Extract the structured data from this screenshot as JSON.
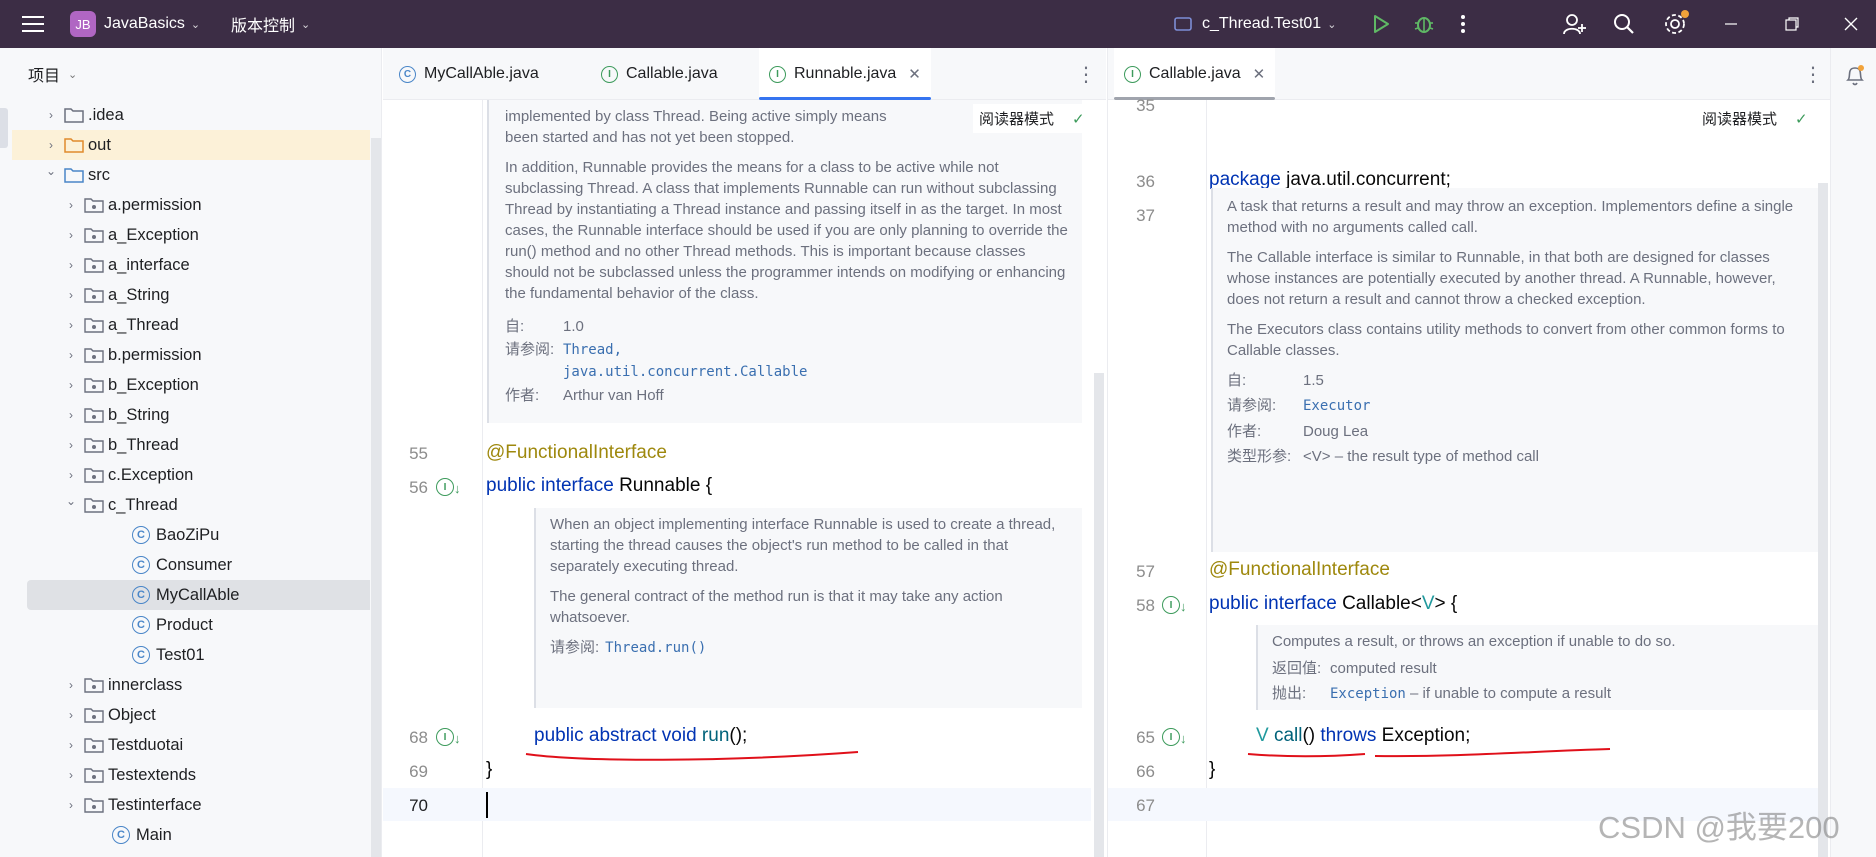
{
  "titlebar": {
    "project_badge": "JB",
    "project_name": "JavaBasics",
    "vcs_label": "版本控制",
    "run_config": "c_Thread.Test01",
    "icons": [
      "hamburger-menu-icon",
      "run-icon",
      "debug-icon",
      "more-vertical-icon",
      "add-user-icon",
      "search-icon",
      "settings-icon",
      "minimize-icon",
      "restore-icon",
      "close-icon"
    ]
  },
  "project_panel": {
    "title": "项目",
    "tree": [
      {
        "label": ".idea",
        "kind": "folder",
        "depth": 1,
        "expanded": false
      },
      {
        "label": "out",
        "kind": "folder-excluded",
        "depth": 1,
        "expanded": false,
        "highlight": true
      },
      {
        "label": "src",
        "kind": "folder-source",
        "depth": 1,
        "expanded": true
      },
      {
        "label": "a.permission",
        "kind": "package",
        "depth": 2,
        "expanded": false
      },
      {
        "label": "a_Exception",
        "kind": "package",
        "depth": 2,
        "expanded": false
      },
      {
        "label": "a_interface",
        "kind": "package",
        "depth": 2,
        "expanded": false
      },
      {
        "label": "a_String",
        "kind": "package",
        "depth": 2,
        "expanded": false
      },
      {
        "label": "a_Thread",
        "kind": "package",
        "depth": 2,
        "expanded": false
      },
      {
        "label": "b.permission",
        "kind": "package",
        "depth": 2,
        "expanded": false
      },
      {
        "label": "b_Exception",
        "kind": "package",
        "depth": 2,
        "expanded": false
      },
      {
        "label": "b_String",
        "kind": "package",
        "depth": 2,
        "expanded": false
      },
      {
        "label": "b_Thread",
        "kind": "package",
        "depth": 2,
        "expanded": false
      },
      {
        "label": "c.Exception",
        "kind": "package",
        "depth": 2,
        "expanded": false
      },
      {
        "label": "c_Thread",
        "kind": "package",
        "depth": 2,
        "expanded": true
      },
      {
        "label": "BaoZiPu",
        "kind": "class",
        "depth": 3
      },
      {
        "label": "Consumer",
        "kind": "class",
        "depth": 3
      },
      {
        "label": "MyCallAble",
        "kind": "class",
        "depth": 3,
        "selected": true
      },
      {
        "label": "Product",
        "kind": "class",
        "depth": 3
      },
      {
        "label": "Test01",
        "kind": "class",
        "depth": 3
      },
      {
        "label": "innerclass",
        "kind": "package",
        "depth": 2,
        "expanded": false
      },
      {
        "label": "Object",
        "kind": "package",
        "depth": 2,
        "expanded": false
      },
      {
        "label": "Testduotai",
        "kind": "package",
        "depth": 2,
        "expanded": false
      },
      {
        "label": "Testextends",
        "kind": "package",
        "depth": 2,
        "expanded": false
      },
      {
        "label": "Testinterface",
        "kind": "package",
        "depth": 2,
        "expanded": false
      },
      {
        "label": "Main",
        "kind": "class",
        "depth": 2
      }
    ]
  },
  "left_editor": {
    "tabs": [
      {
        "label": "MyCallAble.java",
        "icon": "C",
        "active": false
      },
      {
        "label": "Callable.java",
        "icon": "I",
        "active": false
      },
      {
        "label": "Runnable.java",
        "icon": "I",
        "active": true
      }
    ],
    "reader_mode": "阅读器模式",
    "doc_top": {
      "partial_1": "implemented by class Thread. Being active simply means",
      "partial_2": "been started and has not yet been stopped.",
      "para": "In addition, Runnable provides the means for a class to be active while not subclassing Thread. A class that implements Runnable can run without subclassing Thread by instantiating a Thread instance and passing itself in as the target. In most cases, the Runnable interface should be used if you are only planning to override the run() method and no other Thread methods. This is important because classes should not be subclassed unless the programmer intends on modifying or enhancing the fundamental behavior of the class.",
      "since_label": "自:",
      "since_value": "1.0",
      "see_label": "请参阅:",
      "see_1": "Thread,",
      "see_2": "java.util.concurrent.Callable",
      "author_label": "作者:",
      "author_value": "Arthur van Hoff"
    },
    "lines": [
      {
        "n": "55",
        "text": "@FunctionalInterface"
      },
      {
        "n": "56",
        "text": "public interface Runnable {"
      },
      {
        "n": "68",
        "text": "public abstract void run();"
      },
      {
        "n": "69",
        "text": "}"
      },
      {
        "n": "70",
        "text": ""
      }
    ],
    "doc_run": {
      "p1": "When an object implementing interface Runnable is used to create a thread, starting the thread causes the object's run method to be called in that separately executing thread.",
      "p2": "The general contract of the method run is that it may take any action whatsoever.",
      "see_label": "请参阅:",
      "see_value": "Thread.run()"
    }
  },
  "right_editor": {
    "tabs": [
      {
        "label": "Callable.java",
        "icon": "I",
        "active": true
      }
    ],
    "reader_mode": "阅读器模式",
    "lines": [
      {
        "n": "35",
        "text": ""
      },
      {
        "n": "36",
        "text": "package java.util.concurrent;"
      },
      {
        "n": "37",
        "text": ""
      },
      {
        "n": "57",
        "text": "@FunctionalInterface"
      },
      {
        "n": "58",
        "text": "public interface Callable<V> {"
      },
      {
        "n": "65",
        "text": "V call() throws Exception;"
      },
      {
        "n": "66",
        "text": "}"
      },
      {
        "n": "67",
        "text": ""
      }
    ],
    "doc_class": {
      "p1": "A task that returns a result and may throw an exception. Implementors define a single method with no arguments called call.",
      "p2": "The Callable interface is similar to Runnable, in that both are designed for classes whose instances are potentially executed by another thread. A Runnable, however, does not return a result and cannot throw a checked exception.",
      "p3": "The Executors class contains utility methods to convert from other common forms to Callable classes.",
      "since_label": "自:",
      "since_value": "1.5",
      "see_label": "请参阅:",
      "see_value": "Executor",
      "author_label": "作者:",
      "author_value": "Doug Lea",
      "type_param_label": "类型形参:",
      "type_param_value": "<V> – the result type of method call"
    },
    "doc_call": {
      "p1": "Computes a result, or throws an exception if unable to do so.",
      "returns_label": "返回值:",
      "returns_value": "computed result",
      "throws_label": "抛出:",
      "throws_value": "Exception",
      "throws_desc": "– if unable to compute a result"
    }
  },
  "watermark": "CSDN @我要200",
  "colors": {
    "titlebar": "#3c2d45",
    "keyword": "#0033b3",
    "annotation": "#9e880d",
    "type_param": "#20999d",
    "link": "#3a6fb0",
    "underline": "#e0101a",
    "accent": "#3574f0"
  }
}
